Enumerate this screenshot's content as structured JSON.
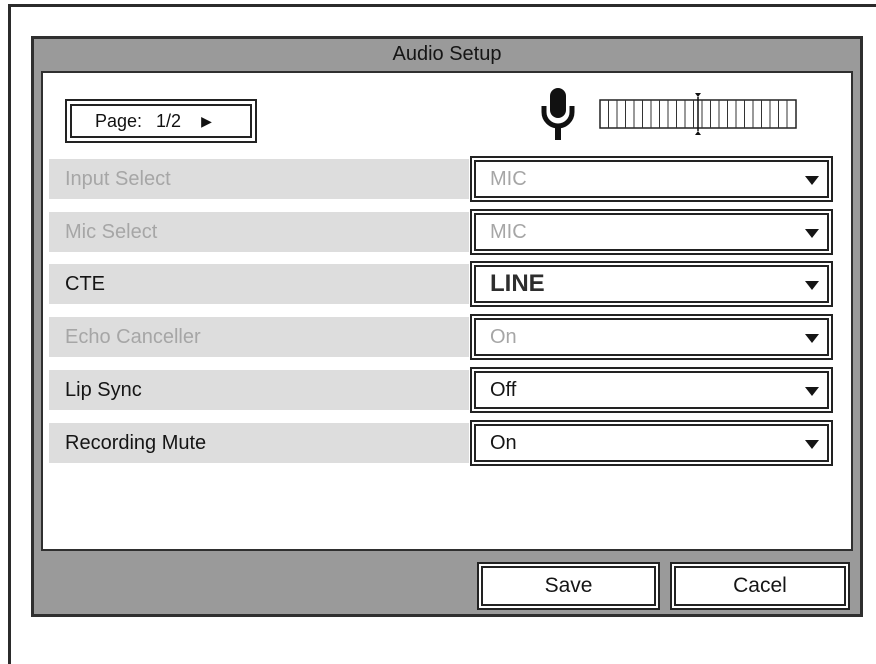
{
  "dialog": {
    "title": "Audio Setup"
  },
  "page_control": {
    "label": "Page:",
    "value": "1/2",
    "next_icon": "triangle-right-icon"
  },
  "level_meter": {
    "mic_icon": "microphone-icon"
  },
  "settings": [
    {
      "label": "Input Select",
      "value": "MIC",
      "enabled": false
    },
    {
      "label": "Mic Select",
      "value": "MIC",
      "enabled": false
    },
    {
      "label": "CTE",
      "value": "LINE",
      "enabled": true
    },
    {
      "label": "Echo Canceller",
      "value": "On",
      "enabled": false
    },
    {
      "label": "Lip Sync",
      "value": "Off",
      "enabled": true
    },
    {
      "label": "Recording Mute",
      "value": "On",
      "enabled": true
    }
  ],
  "footer": {
    "save_label": "Save",
    "cancel_label": "Cacel"
  }
}
